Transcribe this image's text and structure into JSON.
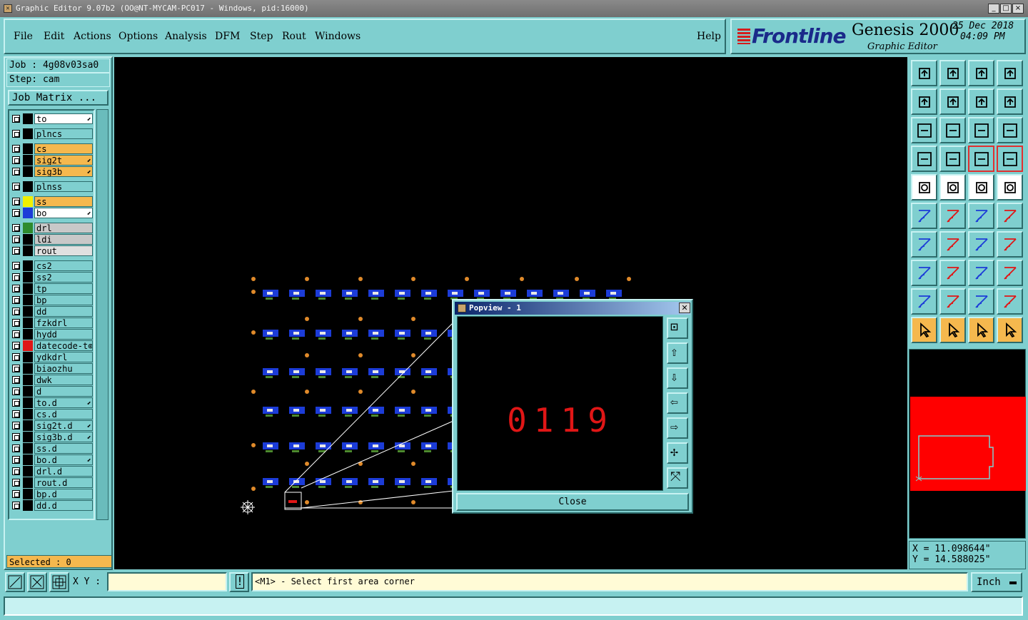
{
  "window": {
    "title": "Graphic Editor 9.07b2 (OO@NT-MYCAM-PC017 - Windows, pid:16000)",
    "controls": [
      "_",
      "□",
      "×"
    ]
  },
  "menu": [
    "File",
    "Edit",
    "Actions",
    "Options",
    "Analysis",
    "DFM",
    "Step",
    "Rout",
    "Windows"
  ],
  "help": "Help",
  "brand": {
    "logo": "Frontline",
    "product": "Genesis 2000",
    "subtitle": "Graphic Editor",
    "date": "25 Dec 2018",
    "time": "04:09 PM"
  },
  "job": {
    "job_line": "Job : 4g08v03sa0",
    "step_line": "Step: cam",
    "matrix_button": "Job Matrix ..."
  },
  "layers": [
    {
      "name": "to",
      "swatch": "#000000",
      "bg": "#ffffff",
      "flag": "⬋"
    },
    {
      "name": "plncs",
      "swatch": "#000000",
      "bg": "#7fcfcf",
      "flag": ""
    },
    {
      "name": "cs",
      "swatch": "#000000",
      "bg": "#f5b84e",
      "flag": ""
    },
    {
      "name": "sig2t",
      "swatch": "#000000",
      "bg": "#f5b84e",
      "flag": "⬋"
    },
    {
      "name": "sig3b",
      "swatch": "#000000",
      "bg": "#f5b84e",
      "flag": "⬋"
    },
    {
      "name": "plnss",
      "swatch": "#000000",
      "bg": "#7fcfcf",
      "flag": ""
    },
    {
      "name": "ss",
      "swatch": "#f0f000",
      "bg": "#f5b84e",
      "flag": ""
    },
    {
      "name": "bo",
      "swatch": "#1c3cd8",
      "bg": "#ffffff",
      "flag": "⬋"
    },
    {
      "name": "drl",
      "swatch": "#2e8b2e",
      "bg": "#c8c8c8",
      "flag": ""
    },
    {
      "name": "ldi",
      "swatch": "#000000",
      "bg": "#c8c8c8",
      "flag": ""
    },
    {
      "name": "rout",
      "swatch": "#000000",
      "bg": "#e0e0e0",
      "flag": ""
    },
    {
      "name": "cs2",
      "swatch": "#000000",
      "bg": "#7fcfcf",
      "flag": ""
    },
    {
      "name": "ss2",
      "swatch": "#000000",
      "bg": "#7fcfcf",
      "flag": ""
    },
    {
      "name": "tp",
      "swatch": "#000000",
      "bg": "#7fcfcf",
      "flag": ""
    },
    {
      "name": "bp",
      "swatch": "#000000",
      "bg": "#7fcfcf",
      "flag": ""
    },
    {
      "name": "dd",
      "swatch": "#000000",
      "bg": "#7fcfcf",
      "flag": ""
    },
    {
      "name": "fzkdrl",
      "swatch": "#000000",
      "bg": "#7fcfcf",
      "flag": ""
    },
    {
      "name": "hydd",
      "swatch": "#000000",
      "bg": "#7fcfcf",
      "flag": ""
    },
    {
      "name": "datecode-t⊕",
      "swatch": "#e01616",
      "bg": "#7fcfcf",
      "flag": ""
    },
    {
      "name": "ydkdrl",
      "swatch": "#000000",
      "bg": "#7fcfcf",
      "flag": ""
    },
    {
      "name": "biaozhu",
      "swatch": "#000000",
      "bg": "#7fcfcf",
      "flag": ""
    },
    {
      "name": "dwk",
      "swatch": "#000000",
      "bg": "#7fcfcf",
      "flag": ""
    },
    {
      "name": "d",
      "swatch": "#000000",
      "bg": "#7fcfcf",
      "flag": ""
    },
    {
      "name": "to.d",
      "swatch": "#000000",
      "bg": "#7fcfcf",
      "flag": "⬋"
    },
    {
      "name": "cs.d",
      "swatch": "#000000",
      "bg": "#7fcfcf",
      "flag": ""
    },
    {
      "name": "sig2t.d",
      "swatch": "#000000",
      "bg": "#7fcfcf",
      "flag": "⬋"
    },
    {
      "name": "sig3b.d",
      "swatch": "#000000",
      "bg": "#7fcfcf",
      "flag": "⬋"
    },
    {
      "name": "ss.d",
      "swatch": "#000000",
      "bg": "#7fcfcf",
      "flag": ""
    },
    {
      "name": "bo.d",
      "swatch": "#000000",
      "bg": "#7fcfcf",
      "flag": "⬋"
    },
    {
      "name": "drl.d",
      "swatch": "#000000",
      "bg": "#7fcfcf",
      "flag": ""
    },
    {
      "name": "rout.d",
      "swatch": "#000000",
      "bg": "#7fcfcf",
      "flag": ""
    },
    {
      "name": "bp.d",
      "swatch": "#000000",
      "bg": "#7fcfcf",
      "flag": ""
    },
    {
      "name": "dd.d",
      "swatch": "#000000",
      "bg": "#7fcfcf",
      "flag": ""
    }
  ],
  "selected": "Selected : 0",
  "popview": {
    "title": "Popview - 1",
    "number": "0119",
    "close_label": "Close",
    "side_buttons": [
      "popview-zoom-window-icon",
      "popview-pan-up-icon",
      "popview-pan-down-icon",
      "popview-pan-left-icon",
      "popview-pan-right-icon",
      "popview-zoom-in-icon",
      "popview-zoom-out-icon"
    ]
  },
  "tools": [
    "home-up-icon",
    "home-down-icon",
    "home-icon",
    "grid-icon",
    "pan-left-icon",
    "pan-right-icon",
    "undo-zoom-icon",
    "redraw-icon",
    "zoom-fit-icon",
    "zoom-center-icon",
    "scale-1-2-icon",
    "help-icon",
    "settings-icon",
    "snap-icon",
    "layer-sel-icon",
    "layer-sel2-icon",
    "pad-icon",
    "area-icon",
    "ruler-icon",
    "circle-icon",
    "net-icon",
    "cross-icon",
    "connect-icon",
    "connect2-icon",
    "angle-icon",
    "line-icon",
    "arc-icon",
    "split-icon",
    "square-pad-icon",
    "minus-icon",
    "measure-icon",
    "group-icon",
    "triangle-icon",
    "triangle2-icon",
    "arch-icon",
    "arch2-icon",
    "pointer-icon",
    "pointer2-icon",
    "pointer3-icon",
    "snap-grid-icon"
  ],
  "coords": {
    "x": "X = 11.098644\"",
    "y": "Y = 14.588025\""
  },
  "bottom": {
    "xy_label": "X Y :",
    "xy_value": "",
    "warning": "!",
    "prompt": "<M1> - Select first area corner",
    "unit": "Inch"
  },
  "colors": {
    "panel": "#7fcfcf",
    "highlight": "#f5b84e",
    "blue_feature": "#1c3cd8",
    "pad": "#e08a2a",
    "red": "#e01616"
  }
}
